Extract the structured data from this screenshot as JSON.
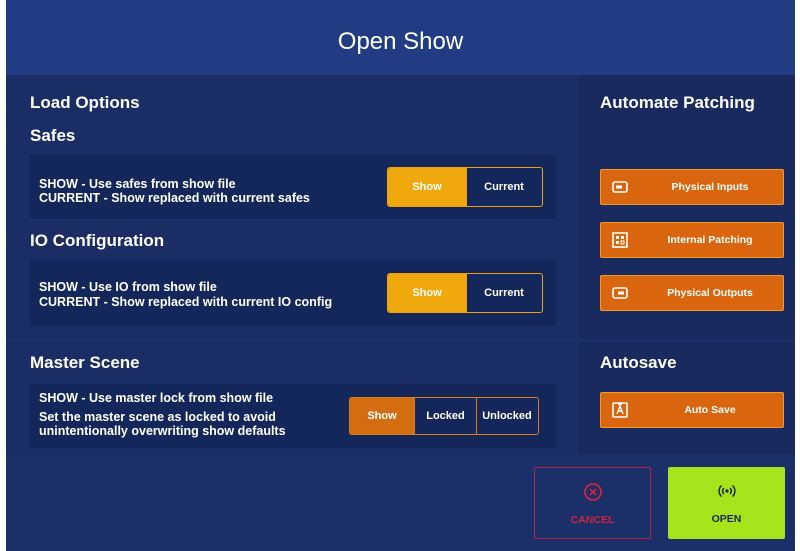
{
  "dialog": {
    "title": "Open Show"
  },
  "load_options": {
    "heading": "Load Options",
    "safes": {
      "heading": "Safes",
      "desc_line1": "SHOW - Use safes from show file",
      "desc_line2": "CURRENT - Show replaced with current safes",
      "options": [
        "Show",
        "Current"
      ],
      "selected": "Show"
    },
    "io": {
      "heading": "IO Configuration",
      "desc_line1": "SHOW - Use IO from show file",
      "desc_line2": "CURRENT - Show replaced with current IO config",
      "options": [
        "Show",
        "Current"
      ],
      "selected": "Show"
    }
  },
  "automate_patching": {
    "heading": "Automate Patching",
    "buttons": [
      "Physical Inputs",
      "Internal Patching",
      "Physical Outputs"
    ],
    "icons": [
      "input-icon",
      "patch-matrix-icon",
      "output-icon"
    ]
  },
  "master_scene": {
    "heading": "Master Scene",
    "desc_line1": "SHOW - Use master lock from show file",
    "desc_line2": "Set the master scene as locked to avoid",
    "desc_line3": "unintentionally overwriting show defaults",
    "options": [
      "Show",
      "Locked",
      "Unlocked"
    ],
    "selected": "Show"
  },
  "autosave": {
    "heading": "Autosave",
    "button": "Auto Save",
    "icon": "autosave-icon"
  },
  "footer": {
    "cancel_label": "CANCEL",
    "open_label": "OPEN"
  },
  "colors": {
    "background": "#1b2f68",
    "title_bar": "#223c83",
    "accent_yellow": "#f0a90c",
    "accent_orange": "#d9660f",
    "cancel_red": "#d0243f",
    "open_green": "#a8e41c"
  }
}
